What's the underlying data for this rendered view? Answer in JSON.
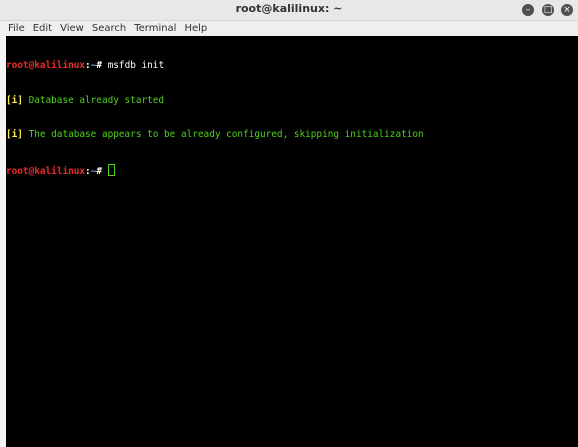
{
  "window": {
    "title": "root@kalilinux: ~",
    "buttons": {
      "minimize": "–",
      "maximize": "□",
      "close": "×"
    }
  },
  "menu": {
    "items": [
      "File",
      "Edit",
      "View",
      "Search",
      "Terminal",
      "Help"
    ]
  },
  "terminal": {
    "prompt_user": "root@kalilinux",
    "prompt_sep": ":",
    "prompt_path": "~",
    "prompt_symbol": "#",
    "command": " msfdb init",
    "output": [
      {
        "tag": "[i]",
        "text": " Database already started"
      },
      {
        "tag": "[i]",
        "text": " The database appears to be already configured, skipping initialization"
      }
    ]
  },
  "colors": {
    "terminal_bg": "#000000",
    "prompt_user": "#ef2929",
    "output_text": "#4ed31a",
    "info_tag": "#fce94f"
  }
}
